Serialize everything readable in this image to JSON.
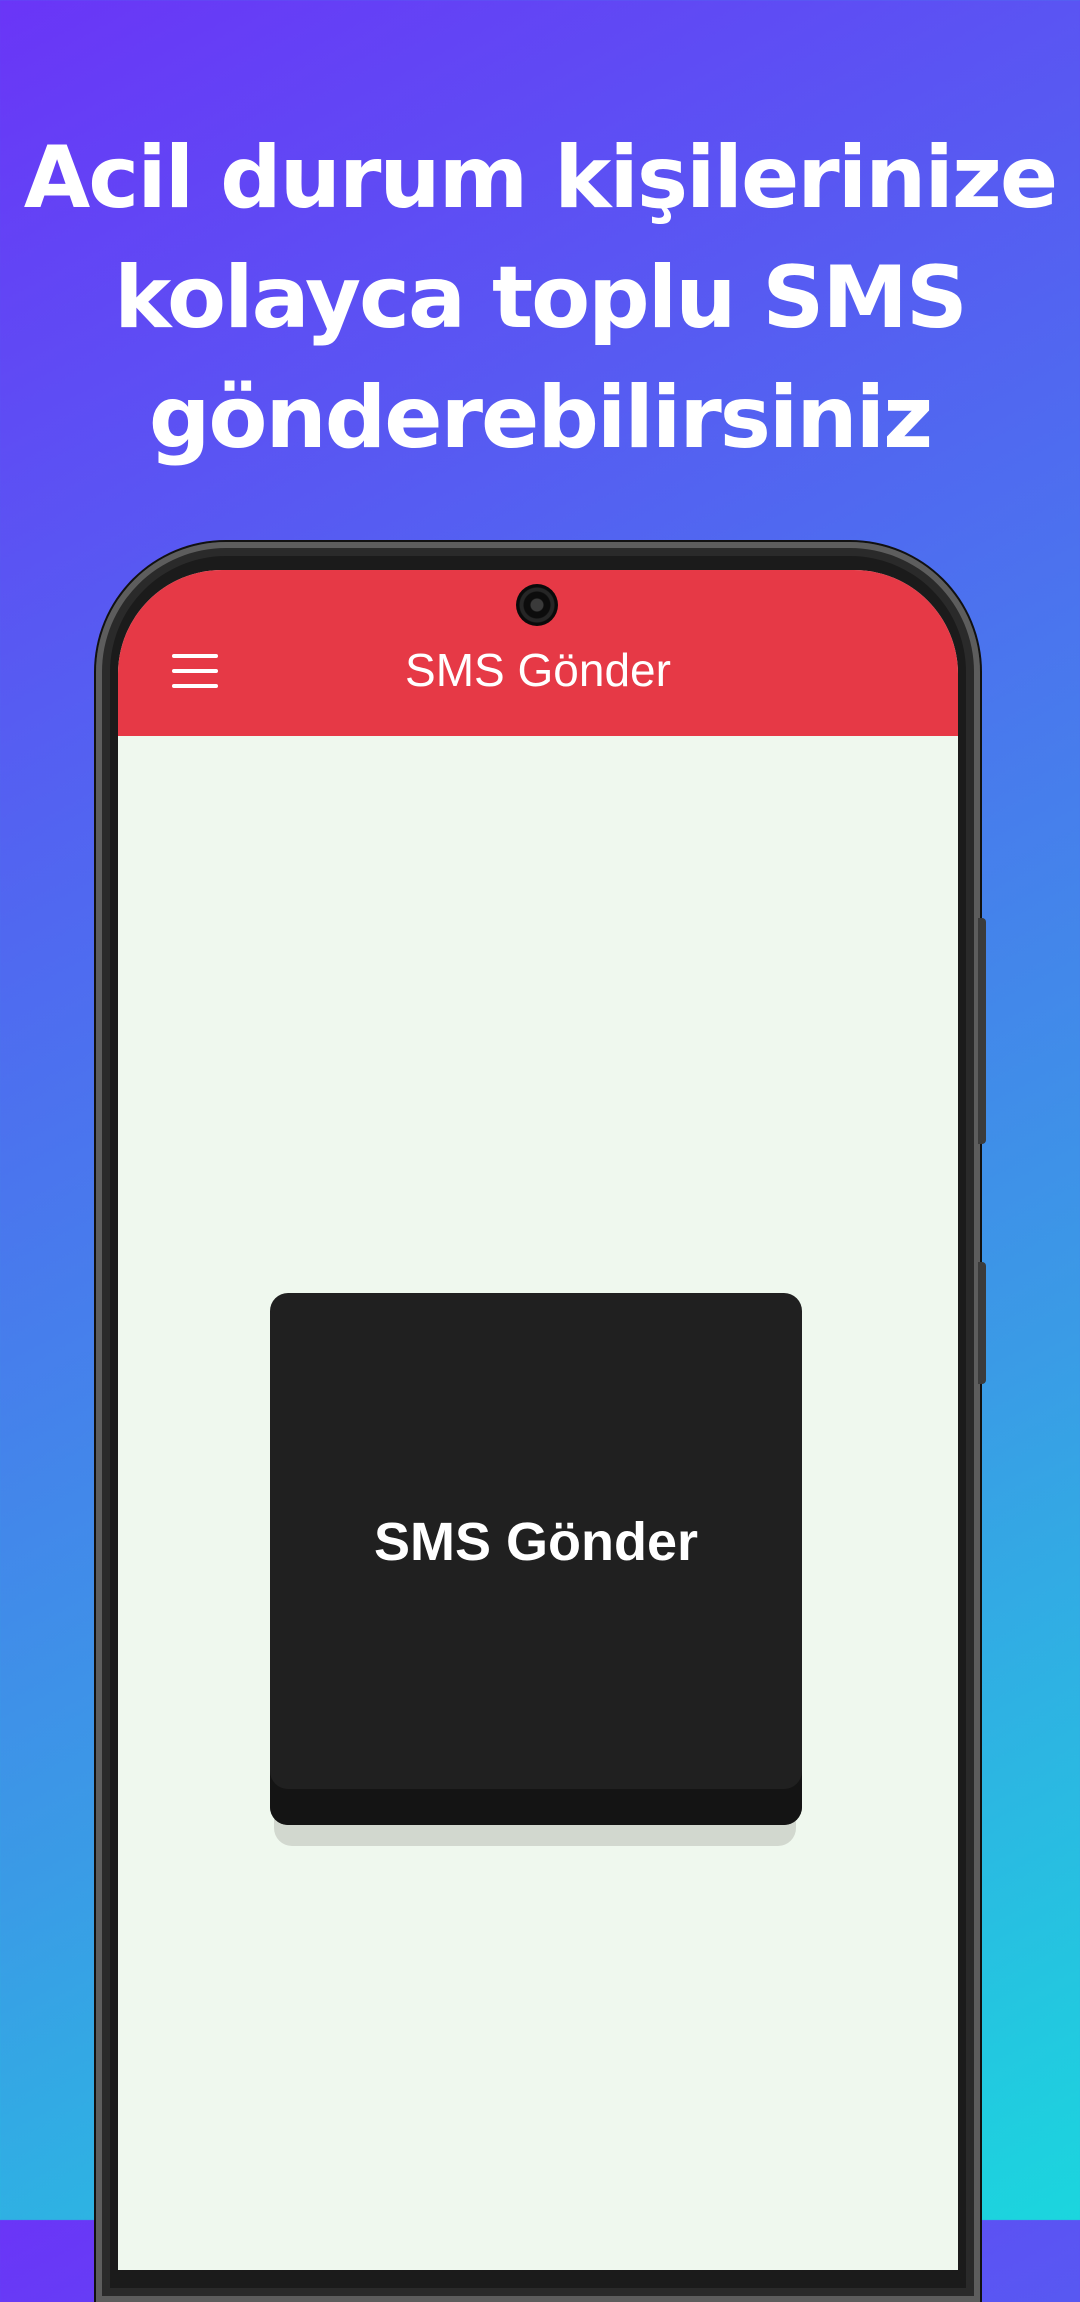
{
  "headline": {
    "line1": "Acil durum kişilerinize",
    "line2": "kolayca toplu SMS",
    "line3": "gönderebilirsiniz"
  },
  "app": {
    "appbar_title": "SMS Gönder",
    "menu_icon": "hamburger-menu-icon",
    "send_button_label": "SMS Gönder"
  },
  "colors": {
    "appbar": "#e63946",
    "screen_background": "#eff8ee",
    "send_button": "#202020",
    "gradient_start": "#6a35f7",
    "gradient_end": "#1bd6de"
  }
}
